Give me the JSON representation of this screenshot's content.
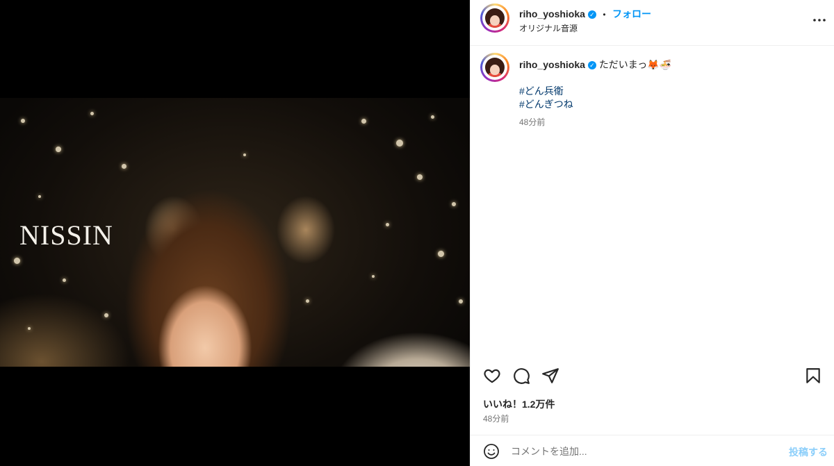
{
  "media": {
    "overlay_text": "NISSIN",
    "mute_icon": "speaker-muted-icon"
  },
  "header": {
    "username": "riho_yoshioka",
    "dot": "•",
    "follow_label": "フォロー",
    "audio_label": "オリジナル音源",
    "more_icon": "more-horizontal-icon"
  },
  "caption": {
    "username": "riho_yoshioka",
    "text": "ただいまっ🦊🍜",
    "hashtags": [
      "#どん兵衛",
      "#どんぎつね"
    ],
    "time": "48分前"
  },
  "actions": {
    "like_icon": "heart-icon",
    "comment_icon": "comment-icon",
    "share_icon": "paper-plane-icon",
    "save_icon": "bookmark-icon"
  },
  "stats": {
    "likes": "いいね！1.2万件",
    "date": "48分前"
  },
  "comment": {
    "placeholder": "コメントを追加...",
    "post_label": "投稿する",
    "emoji_icon": "emoji-icon"
  },
  "colors": {
    "accent": "#0095f6",
    "hashtag": "#00376b",
    "border": "#efefef"
  }
}
